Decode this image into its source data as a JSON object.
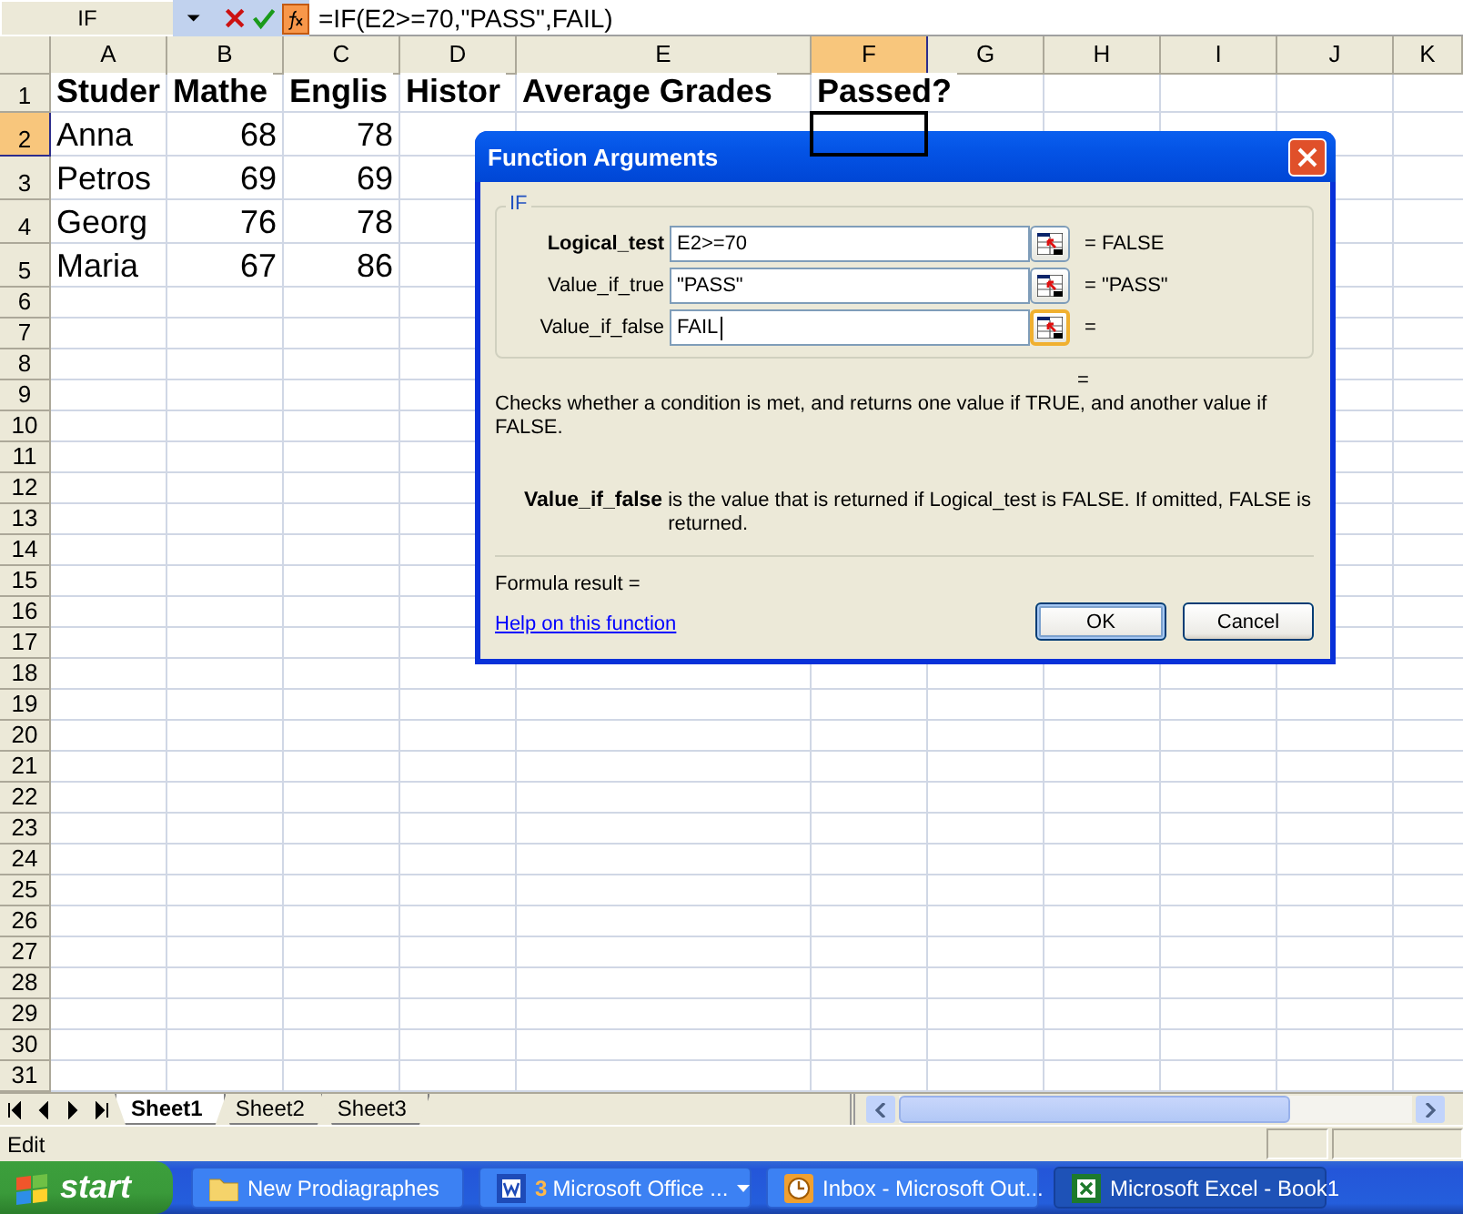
{
  "formula_bar": {
    "name_box": "IF",
    "formula": "=IF(E2>=70,\"PASS\",FAIL)"
  },
  "grid": {
    "columns": [
      {
        "label": "A",
        "selected": false
      },
      {
        "label": "B",
        "selected": false
      },
      {
        "label": "C",
        "selected": false
      },
      {
        "label": "D",
        "selected": false
      },
      {
        "label": "E",
        "selected": false
      },
      {
        "label": "F",
        "selected": true
      },
      {
        "label": "G",
        "selected": false
      },
      {
        "label": "H",
        "selected": false
      },
      {
        "label": "I",
        "selected": false
      },
      {
        "label": "J",
        "selected": false
      },
      {
        "label": "K",
        "selected": false
      }
    ],
    "rows": [
      {
        "label": "1",
        "selected": false,
        "cells": [
          {
            "kind": "heading",
            "text": "Studer"
          },
          {
            "kind": "heading",
            "text": "Mathe"
          },
          {
            "kind": "heading",
            "text": "Englis"
          },
          {
            "kind": "heading",
            "text": "Histor"
          },
          {
            "kind": "heading",
            "text": "Average Grades"
          },
          {
            "kind": "heading",
            "text": "Passed?"
          }
        ]
      },
      {
        "label": "2",
        "selected": true,
        "cells": [
          {
            "kind": "text",
            "text": "Anna"
          },
          {
            "kind": "number",
            "text": "68"
          },
          {
            "kind": "number",
            "text": "78"
          }
        ]
      },
      {
        "label": "3",
        "selected": false,
        "cells": [
          {
            "kind": "text",
            "text": "Petros"
          },
          {
            "kind": "number",
            "text": "69"
          },
          {
            "kind": "number",
            "text": "69"
          }
        ]
      },
      {
        "label": "4",
        "selected": false,
        "cells": [
          {
            "kind": "text",
            "text": "Georg"
          },
          {
            "kind": "number",
            "text": "76"
          },
          {
            "kind": "number",
            "text": "78"
          }
        ]
      },
      {
        "label": "5",
        "selected": false,
        "cells": [
          {
            "kind": "text",
            "text": "Maria"
          },
          {
            "kind": "number",
            "text": "67"
          },
          {
            "kind": "number",
            "text": "86"
          }
        ]
      },
      {
        "label": "6",
        "selected": false,
        "cells": []
      },
      {
        "label": "7",
        "selected": false,
        "cells": []
      },
      {
        "label": "8",
        "selected": false,
        "cells": []
      },
      {
        "label": "9",
        "selected": false,
        "cells": []
      },
      {
        "label": "10",
        "selected": false,
        "cells": []
      },
      {
        "label": "11",
        "selected": false,
        "cells": []
      },
      {
        "label": "12",
        "selected": false,
        "cells": []
      },
      {
        "label": "13",
        "selected": false,
        "cells": []
      },
      {
        "label": "14",
        "selected": false,
        "cells": []
      },
      {
        "label": "15",
        "selected": false,
        "cells": []
      },
      {
        "label": "16",
        "selected": false,
        "cells": []
      },
      {
        "label": "17",
        "selected": false,
        "cells": []
      },
      {
        "label": "18",
        "selected": false,
        "cells": []
      },
      {
        "label": "19",
        "selected": false,
        "cells": []
      },
      {
        "label": "20",
        "selected": false,
        "cells": []
      },
      {
        "label": "21",
        "selected": false,
        "cells": []
      },
      {
        "label": "22",
        "selected": false,
        "cells": []
      },
      {
        "label": "23",
        "selected": false,
        "cells": []
      },
      {
        "label": "24",
        "selected": false,
        "cells": []
      },
      {
        "label": "25",
        "selected": false,
        "cells": []
      },
      {
        "label": "26",
        "selected": false,
        "cells": []
      },
      {
        "label": "27",
        "selected": false,
        "cells": []
      },
      {
        "label": "28",
        "selected": false,
        "cells": []
      },
      {
        "label": "29",
        "selected": false,
        "cells": []
      },
      {
        "label": "30",
        "selected": false,
        "cells": []
      },
      {
        "label": "31",
        "selected": false,
        "cells": []
      }
    ]
  },
  "dialog": {
    "title": "Function Arguments",
    "function_name": "IF",
    "arguments": [
      {
        "label": "Logical_test",
        "value": "E2>=70",
        "result": "= FALSE",
        "required": true,
        "focused": false
      },
      {
        "label": "Value_if_true",
        "value": "\"PASS\"",
        "result": "= \"PASS\"",
        "required": false,
        "focused": false
      },
      {
        "label": "Value_if_false",
        "value": "FAIL",
        "result": "=",
        "required": false,
        "focused": true
      }
    ],
    "preview": "=",
    "description": "Checks whether a condition is met, and returns one value if TRUE, and another value if FALSE.",
    "argument_help": {
      "name": "Value_if_false",
      "text": "is the value that is returned if Logical_test is FALSE. If omitted, FALSE is returned."
    },
    "formula_result": "Formula result =",
    "help_link": "Help on this function",
    "buttons": [
      {
        "label": "OK",
        "default": true
      },
      {
        "label": "Cancel",
        "default": false
      }
    ]
  },
  "sheet_tabs": [
    {
      "label": "Sheet1",
      "selected": true
    },
    {
      "label": "Sheet2",
      "selected": false
    },
    {
      "label": "Sheet3",
      "selected": false
    }
  ],
  "status_bar": {
    "mode": "Edit"
  },
  "taskbar": {
    "start": "start",
    "items": [
      {
        "kind": "folder",
        "label": "New Prodiagraphes",
        "selected": false
      },
      {
        "kind": "word",
        "count": "3",
        "label": "Microsoft Office ...",
        "selected": false
      },
      {
        "kind": "outlook",
        "label": "Inbox - Microsoft Out...",
        "selected": false
      },
      {
        "kind": "excel",
        "label": "Microsoft Excel - Book1",
        "selected": true
      }
    ]
  }
}
